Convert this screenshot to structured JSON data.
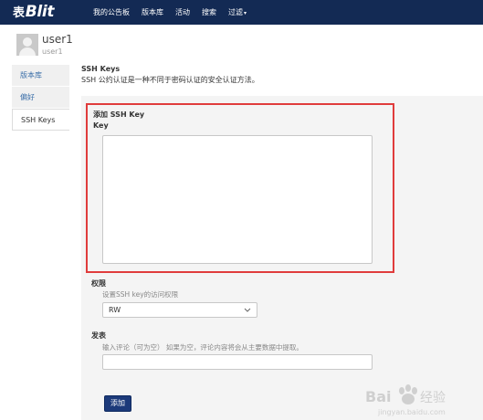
{
  "header": {
    "logo_glyph": "表",
    "logo_text": "Blit",
    "nav": [
      {
        "label": "我的公告板"
      },
      {
        "label": "版本库"
      },
      {
        "label": "活动"
      },
      {
        "label": "搜索"
      },
      {
        "label": "过滤"
      }
    ]
  },
  "user": {
    "name": "user1",
    "handle": "user1"
  },
  "sidebar": {
    "items": [
      {
        "label": "版本库"
      },
      {
        "label": "偏好"
      },
      {
        "label": "SSH Keys"
      }
    ]
  },
  "main": {
    "title": "SSH Keys",
    "description": "SSH 公约认证是一种不同于密码认证的安全认证方法。"
  },
  "form": {
    "add_title": "添加 SSH Key",
    "key_label": "Key",
    "key_value": "",
    "permission_label": "权限",
    "permission_hint": "设置SSH key的访问权限",
    "permission_value": "RW",
    "comment_label": "发表",
    "comment_hint": "输入评论（可为空）  如果为空，评论内容将会从主要数据中提取。",
    "comment_value": "",
    "submit_label": "添加"
  },
  "watermark": {
    "brand": "Bai",
    "brand_suffix": "经验",
    "url": "jingyan.baidu.com"
  },
  "colors": {
    "topbar": "#132a54",
    "highlight": "#e03c3c",
    "button": "#1c3a7a",
    "link": "#3a6ea8"
  }
}
